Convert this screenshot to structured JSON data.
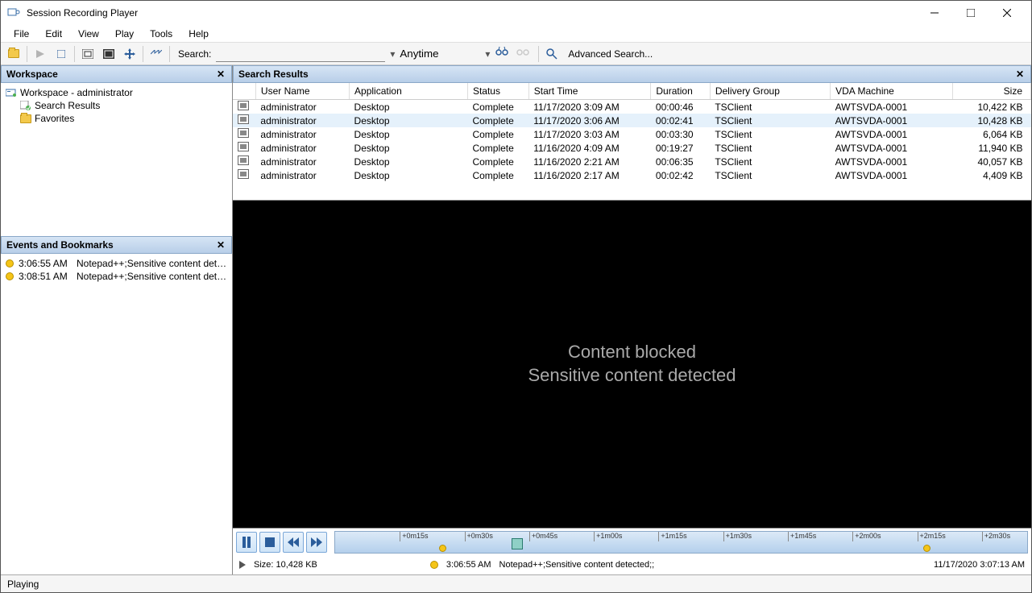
{
  "window": {
    "title": "Session Recording Player"
  },
  "menu": {
    "file": "File",
    "edit": "Edit",
    "view": "View",
    "play": "Play",
    "tools": "Tools",
    "help": "Help"
  },
  "toolbar": {
    "search_label": "Search:",
    "search_value": "",
    "anytime": "Anytime",
    "advanced": "Advanced Search..."
  },
  "panels": {
    "workspace": "Workspace",
    "events": "Events and Bookmarks",
    "results": "Search Results"
  },
  "workspace_tree": {
    "root": "Workspace - administrator",
    "search_results": "Search Results",
    "favorites": "Favorites"
  },
  "events": [
    {
      "time": "3:06:55 AM",
      "text": "Notepad++;Sensitive content detecte..."
    },
    {
      "time": "3:08:51 AM",
      "text": "Notepad++;Sensitive content detecte..."
    }
  ],
  "results": {
    "headers": {
      "user": "User Name",
      "app": "Application",
      "status": "Status",
      "start": "Start Time",
      "duration": "Duration",
      "dg": "Delivery Group",
      "vda": "VDA Machine",
      "size": "Size"
    },
    "rows": [
      {
        "user": "administrator",
        "app": "Desktop",
        "status": "Complete",
        "start": "11/17/2020 3:09 AM",
        "duration": "00:00:46",
        "dg": "TSClient",
        "vda": "AWTSVDA-0001",
        "size": "10,422 KB"
      },
      {
        "user": "administrator",
        "app": "Desktop",
        "status": "Complete",
        "start": "11/17/2020 3:06 AM",
        "duration": "00:02:41",
        "dg": "TSClient",
        "vda": "AWTSVDA-0001",
        "size": "10,428 KB",
        "selected": true
      },
      {
        "user": "administrator",
        "app": "Desktop",
        "status": "Complete",
        "start": "11/17/2020 3:03 AM",
        "duration": "00:03:30",
        "dg": "TSClient",
        "vda": "AWTSVDA-0001",
        "size": "6,064 KB"
      },
      {
        "user": "administrator",
        "app": "Desktop",
        "status": "Complete",
        "start": "11/16/2020 4:09 AM",
        "duration": "00:19:27",
        "dg": "TSClient",
        "vda": "AWTSVDA-0001",
        "size": "11,940 KB"
      },
      {
        "user": "administrator",
        "app": "Desktop",
        "status": "Complete",
        "start": "11/16/2020 2:21 AM",
        "duration": "00:06:35",
        "dg": "TSClient",
        "vda": "AWTSVDA-0001",
        "size": "40,057 KB"
      },
      {
        "user": "administrator",
        "app": "Desktop",
        "status": "Complete",
        "start": "11/16/2020 2:17 AM",
        "duration": "00:02:42",
        "dg": "TSClient",
        "vda": "AWTSVDA-0001",
        "size": "4,409 KB"
      }
    ]
  },
  "viewport": {
    "line1": "Content blocked",
    "line2": "Sensitive content detected"
  },
  "timeline": {
    "ticks": [
      "+0m15s",
      "+0m30s",
      "+0m45s",
      "+1m00s",
      "+1m15s",
      "+1m30s",
      "+1m45s",
      "+2m00s",
      "+2m15s",
      "+2m30s"
    ]
  },
  "playback_info": {
    "size_label": "Size: 10,428 KB",
    "event_time": "3:06:55 AM",
    "event_text": "Notepad++;Sensitive content detected;;",
    "timestamp": "11/17/2020 3:07:13 AM"
  },
  "statusbar": {
    "status": "Playing"
  }
}
